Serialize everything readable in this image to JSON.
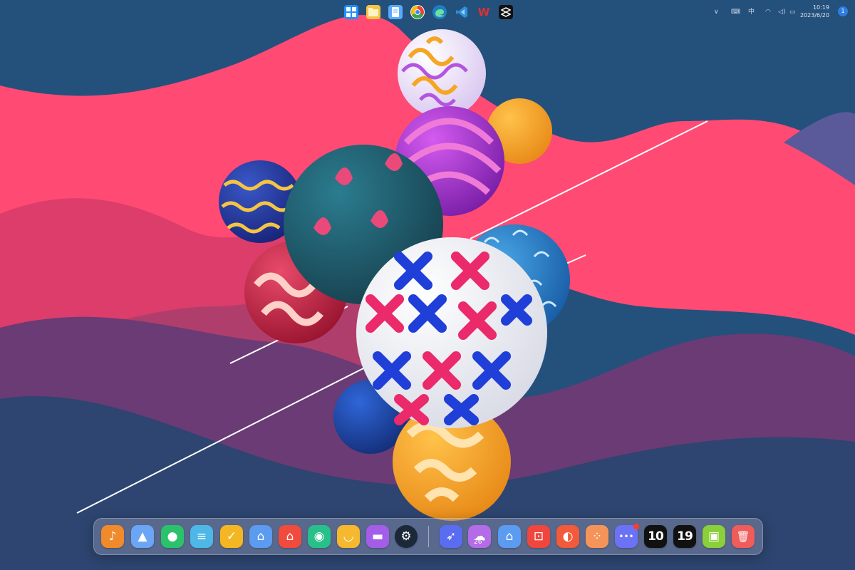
{
  "taskbar": {
    "apps": [
      {
        "name": "start-icon",
        "color": "#1e90ff"
      },
      {
        "name": "file-explorer-icon",
        "color": "#f5c542"
      },
      {
        "name": "notepad-icon",
        "color": "#5aa9ff"
      },
      {
        "name": "chrome-icon",
        "color": "#ea4335"
      },
      {
        "name": "edge-icon",
        "color": "#2aa0d8"
      },
      {
        "name": "vscode-icon",
        "color": "#2f8fd8"
      },
      {
        "name": "wps-icon",
        "color": "#e0302f"
      },
      {
        "name": "capcut-icon",
        "color": "#111111"
      }
    ],
    "clock": {
      "time": "10:19",
      "date": "2023/6/20"
    },
    "notification_count": "1",
    "input_indicator": "中"
  },
  "dock": {
    "left_apps": [
      {
        "name": "music-app-icon",
        "color": "#f08a2a",
        "glyph": "♪"
      },
      {
        "name": "docs-app-icon",
        "color": "#6aa6f5",
        "glyph": "▲"
      },
      {
        "name": "wechat-app-icon",
        "color": "#2bc26b",
        "glyph": "●"
      },
      {
        "name": "storage-app-icon",
        "color": "#4fb7e8",
        "glyph": "≡"
      },
      {
        "name": "security-app-icon",
        "color": "#f4b623",
        "glyph": "✓"
      },
      {
        "name": "store-app-icon",
        "color": "#5b9bf0",
        "glyph": "⌂"
      },
      {
        "name": "home-app-icon",
        "color": "#f04b3d",
        "glyph": "⌂"
      },
      {
        "name": "car-app-icon",
        "color": "#27c08a",
        "glyph": "◉"
      },
      {
        "name": "bowl-app-icon",
        "color": "#f5b82e",
        "glyph": "◡"
      },
      {
        "name": "folder-app-icon",
        "color": "#a45de8",
        "glyph": "▬"
      },
      {
        "name": "steam-app-icon",
        "color": "#1b2838",
        "glyph": "⚙"
      }
    ],
    "right_apps": [
      {
        "name": "rocket-app-icon",
        "color": "#5a6cf0",
        "glyph": "➶"
      },
      {
        "name": "weather-app-icon",
        "color": "#b46be8",
        "glyph": "☁",
        "label": "26°"
      },
      {
        "name": "appstore-app-icon",
        "color": "#5b9bf0",
        "glyph": "⌂"
      },
      {
        "name": "screenshot-app-icon",
        "color": "#f0463d",
        "glyph": "⊡"
      },
      {
        "name": "palette-app-icon",
        "color": "#f25a3a",
        "glyph": "◐"
      },
      {
        "name": "grid-app-icon",
        "color": "#f5945a",
        "glyph": "⁘"
      },
      {
        "name": "more-app-icon",
        "color": "#6c72f5",
        "glyph": "•••",
        "badge": true
      },
      {
        "name": "clock-hour-widget",
        "color": "#111111",
        "text": "10"
      },
      {
        "name": "clock-minute-widget",
        "color": "#111111",
        "text": "19"
      },
      {
        "name": "installer-app-icon",
        "color": "#8bcf3a",
        "glyph": "▣"
      },
      {
        "name": "trash-app-icon",
        "color": "#f05c5c",
        "glyph": "🗑"
      }
    ]
  }
}
